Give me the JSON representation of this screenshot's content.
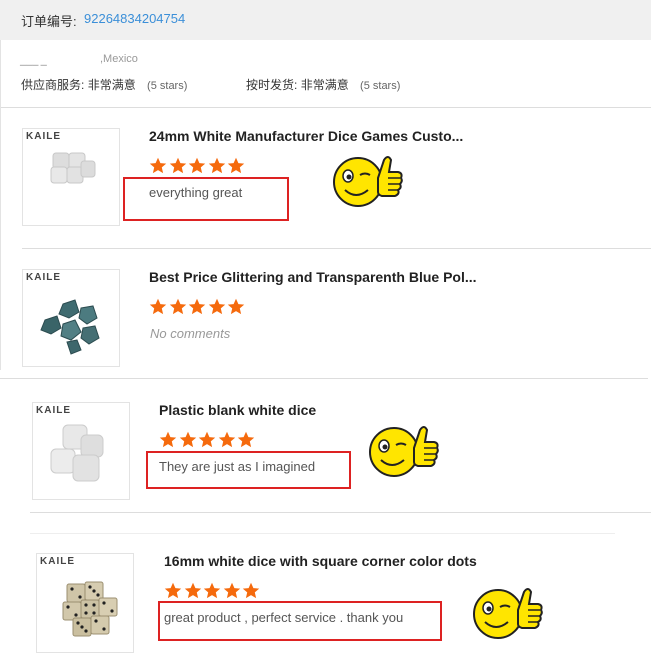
{
  "order": {
    "label": "订单编号:",
    "number": "92264834204754"
  },
  "location": ",Mexico",
  "supplier_service": {
    "label": "供应商服务:",
    "value": "非常满意",
    "stars_text": "(5 stars)"
  },
  "shipping": {
    "label": "按时发货:",
    "value": "非常满意",
    "stars_text": "(5 stars)"
  },
  "brand": "KAILE",
  "colors": {
    "star": "#f56a0d",
    "highlight": "#dd2222",
    "link": "#3b8fd8"
  },
  "products": [
    {
      "title": "24mm White Manufacturer Dice Games Custo...",
      "rating": 5,
      "comment": "everything great",
      "has_comment": true
    },
    {
      "title": "Best Price Glittering and Transparenth Blue Pol...",
      "rating": 5,
      "comment": "No comments",
      "has_comment": false
    },
    {
      "title": "Plastic blank white dice",
      "rating": 5,
      "comment": "They are just as I imagined",
      "has_comment": true
    },
    {
      "title": "16mm white dice with square corner color dots",
      "rating": 5,
      "comment": "great product , perfect service . thank you",
      "has_comment": true
    }
  ],
  "icons": {
    "star": "star-icon",
    "thumbs_up": "thumbs-up-smiley-icon"
  }
}
